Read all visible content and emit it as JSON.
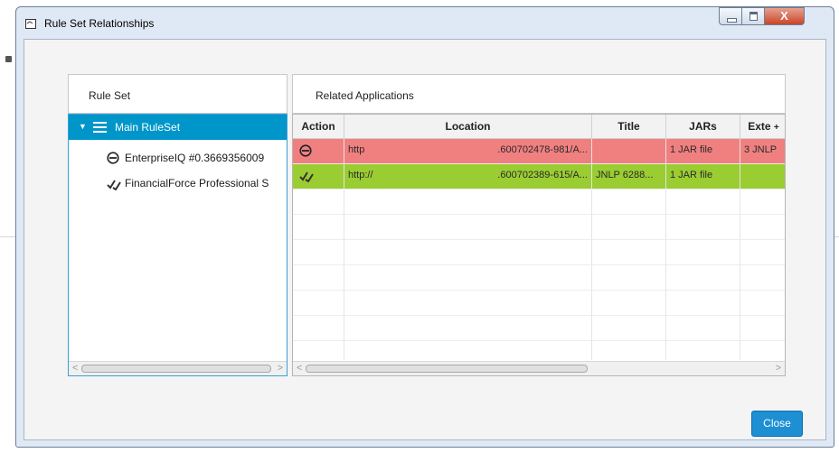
{
  "window": {
    "title": "Rule Set Relationships",
    "controls": {
      "minimize": "minimize",
      "maximize": "maximize",
      "close": "X"
    }
  },
  "rule_set_panel": {
    "header": "Rule Set",
    "items": [
      {
        "label": "Main RuleSet",
        "icon": "menu-lines-icon",
        "expanded": true,
        "selected": true
      },
      {
        "label": "EnterpriseIQ #0.3669356009",
        "icon": "block-circle-icon"
      },
      {
        "label": "FinancialForce Professional S",
        "icon": "double-check-icon"
      }
    ]
  },
  "related_panel": {
    "header": "Related Applications",
    "columns": [
      "Action",
      "Location",
      "Title",
      "JARs",
      "Exte"
    ],
    "sort_indicator": "+",
    "rows": [
      {
        "action_icon": "block-circle-icon",
        "location_start": "http",
        "location_end": ".600702478-981/A...",
        "title": "",
        "jars": "1 JAR file",
        "ext": "3 JNLP",
        "color": "#f08080"
      },
      {
        "action_icon": "double-check-icon",
        "location_start": "http://",
        "location_end": ".600702389-615/A...",
        "title": "JNLP 6288...",
        "jars": "1 JAR file",
        "ext": "",
        "color": "#9acd32"
      }
    ]
  },
  "colors": {
    "accent": "#0096c9",
    "deny_row": "#f08080",
    "allow_row": "#9acd32",
    "close_button": "#1e8fd3"
  },
  "buttons": {
    "close": "Close"
  }
}
